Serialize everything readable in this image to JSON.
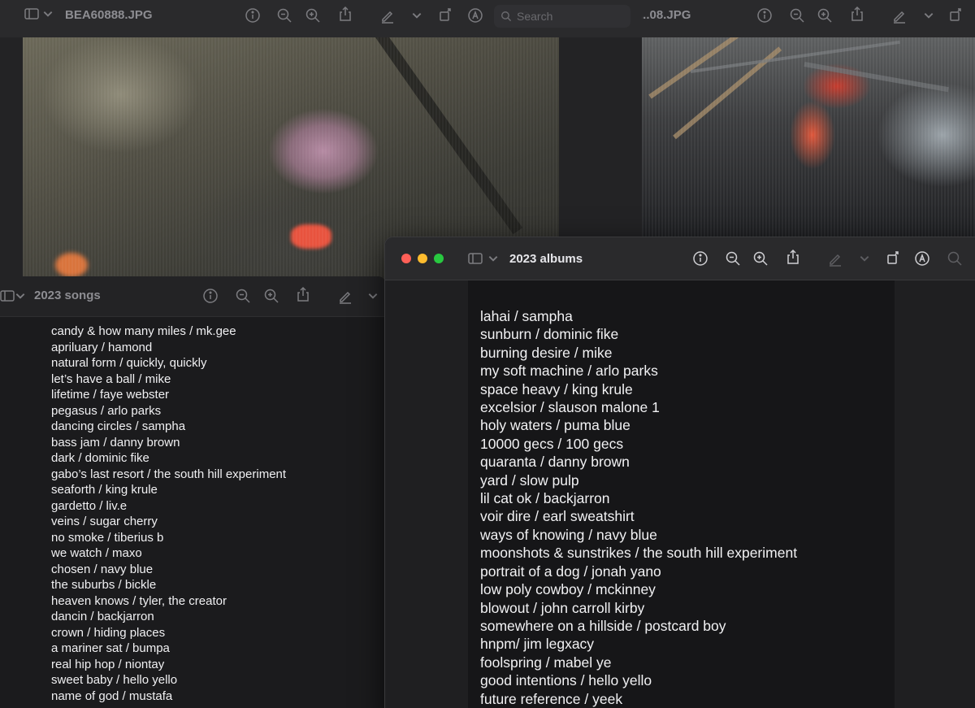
{
  "photo_window_1": {
    "title": "BEA60888.JPG",
    "search_placeholder": "Search"
  },
  "photo_window_2": {
    "title": "...08.JPG"
  },
  "songs_window": {
    "title": "2023 songs",
    "items": [
      "candy & how many miles / mk.gee",
      "apriluary / hamond",
      "natural form / quickly, quickly",
      "let’s have a ball / mike",
      "lifetime / faye webster",
      "pegasus / arlo parks",
      "dancing circles / sampha",
      "bass jam / danny brown",
      "dark / dominic fike",
      "gabo’s last resort / the south hill experiment",
      "seaforth / king krule",
      "gardetto / liv.e",
      "veins / sugar cherry",
      "no smoke / tiberius b",
      "we watch / maxo",
      "chosen / navy blue",
      "the suburbs / bickle",
      "heaven knows / tyler, the creator",
      "dancin / backjarron",
      "crown / hiding places",
      "a mariner sat / bumpa",
      "real hip hop / niontay",
      "sweet baby / hello yello",
      "name of god / mustafa"
    ]
  },
  "albums_window": {
    "title": "2023 albums",
    "items": [
      "lahai / sampha",
      "sunburn / dominic fike",
      "burning desire / mike",
      "my soft machine / arlo parks",
      "space heavy / king krule",
      "excelsior / slauson malone 1",
      "holy waters / puma blue",
      "10000 gecs / 100 gecs",
      "quaranta / danny brown",
      "yard / slow pulp",
      "lil cat ok / backjarron",
      "voir dire / earl sweatshirt",
      "ways of knowing / navy blue",
      "moonshots & sunstrikes / the south hill experiment",
      "portrait of a dog / jonah yano",
      "low poly cowboy / mckinney",
      "blowout / john carroll kirby",
      "somewhere on a hillside / postcard boy",
      "hnpm/ jim legxacy",
      "foolspring / mabel ye",
      "good intentions / hello yello",
      "future reference / yeek"
    ]
  },
  "colors": {
    "close": "#ff5f57",
    "minimize": "#febc2e",
    "zoom": "#28c840"
  }
}
